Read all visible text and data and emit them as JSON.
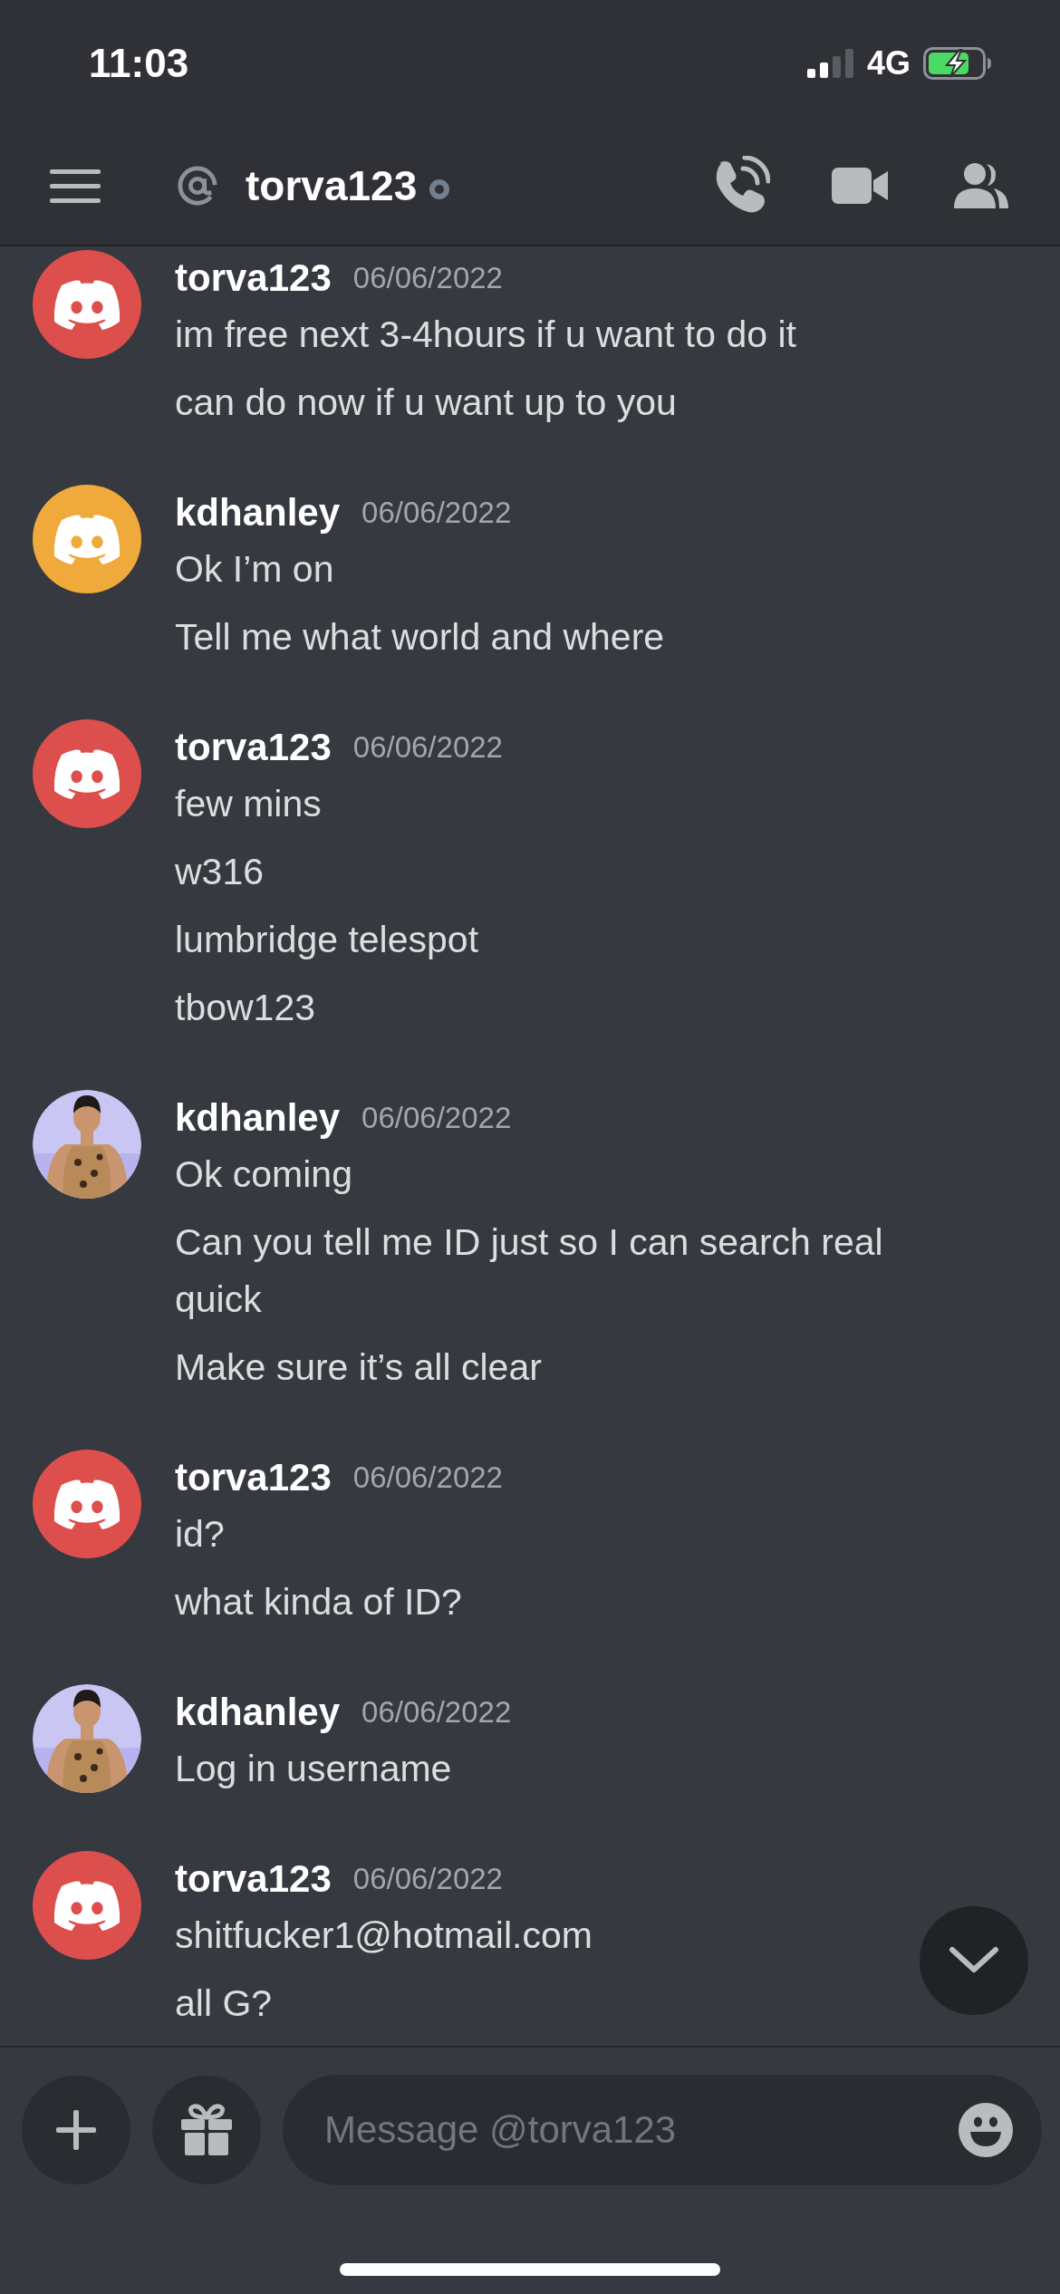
{
  "status_bar": {
    "time": "11:03",
    "network": "4G"
  },
  "header": {
    "title": "torva123",
    "online": false
  },
  "messages": [
    {
      "author": "torva123",
      "date": "06/06/2022",
      "avatar": {
        "kind": "default",
        "color": "#dd4f4d"
      },
      "lines": [
        "im free next 3-4hours if u want to do it",
        "can do now if u want up to you"
      ]
    },
    {
      "author": "kdhanley",
      "date": "06/06/2022",
      "avatar": {
        "kind": "default",
        "color": "#f0a93b"
      },
      "lines": [
        "Ok I’m on",
        "Tell me what world and where"
      ]
    },
    {
      "author": "torva123",
      "date": "06/06/2022",
      "avatar": {
        "kind": "default",
        "color": "#dd4f4d"
      },
      "lines": [
        "few mins",
        "w316",
        "lumbridge telespot",
        "tbow123"
      ]
    },
    {
      "author": "kdhanley",
      "date": "06/06/2022",
      "avatar": {
        "kind": "picture"
      },
      "lines": [
        "Ok coming",
        "Can you tell me ID just so I can search real quick",
        "Make sure it’s all clear"
      ]
    },
    {
      "author": "torva123",
      "date": "06/06/2022",
      "avatar": {
        "kind": "default",
        "color": "#dd4f4d"
      },
      "lines": [
        "id?",
        "what kinda of ID?"
      ]
    },
    {
      "author": "kdhanley",
      "date": "06/06/2022",
      "avatar": {
        "kind": "picture"
      },
      "lines": [
        "Log in username"
      ]
    },
    {
      "author": "torva123",
      "date": "06/06/2022",
      "avatar": {
        "kind": "default",
        "color": "#dd4f4d"
      },
      "lines": [
        "shitfucker1@hotmail.com",
        "all G?"
      ]
    }
  ],
  "composer": {
    "placeholder": "Message @torva123"
  }
}
